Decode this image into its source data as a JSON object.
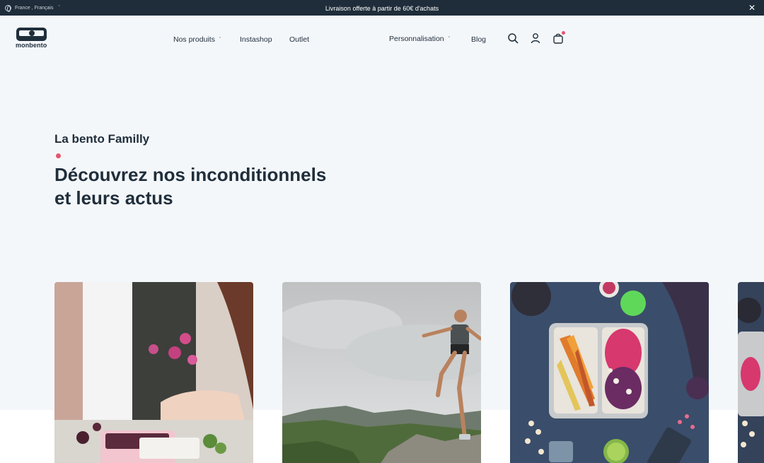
{
  "promo_bar": {
    "locale": "France , Français",
    "message": "Livraison offerte à partir de 60€ d'achats"
  },
  "header": {
    "logo_text": "monbento",
    "nav": [
      {
        "label": "Nos produits",
        "has_dropdown": true
      },
      {
        "label": "Instashop",
        "has_dropdown": false
      },
      {
        "label": "Outlet",
        "has_dropdown": false
      },
      {
        "label": "Personnalisation",
        "has_dropdown": true
      },
      {
        "label": "Blog",
        "has_dropdown": false
      }
    ],
    "icons": [
      "search-icon",
      "account-icon",
      "cart-icon"
    ]
  },
  "hero": {
    "eyebrow": "La bento Familly",
    "title_line1": "Découvrez nos inconditionnels",
    "title_line2": "et leurs actus"
  },
  "cards": [
    {
      "image": "woman-preparing-bento-photo"
    },
    {
      "image": "trail-runner-mountains-photo"
    },
    {
      "image": "colorful-bento-lunch-photo"
    },
    {
      "image": "partial-card-photo"
    }
  ],
  "colors": {
    "dark": "#1f2d3a",
    "accent": "#e8546c",
    "hero_bg": "#f4f7fa"
  }
}
